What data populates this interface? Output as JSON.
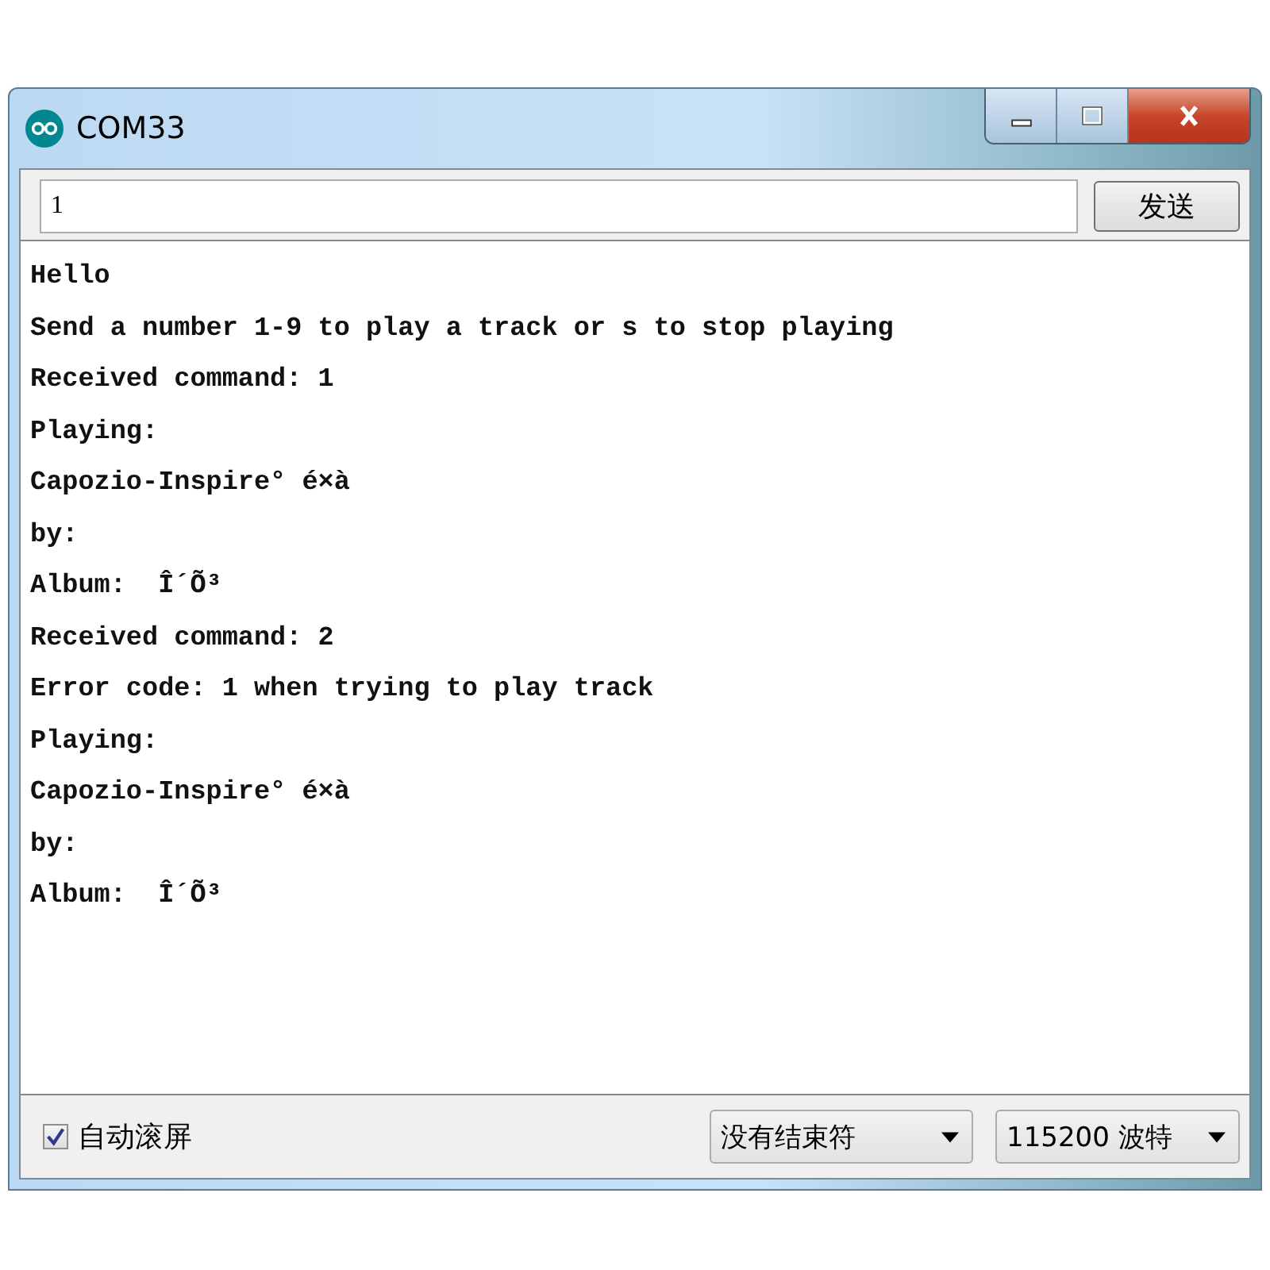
{
  "window": {
    "title": "COM33"
  },
  "send_field": {
    "value": "1"
  },
  "send_button": {
    "label": "发送"
  },
  "output_lines": [
    "Hello",
    "Send a number 1-9 to play a track or s to stop playing",
    "Received command: 1",
    "Playing:",
    "Capozio-Inspire° é×à",
    "by:",
    "Album:  Î´Õ³",
    "Received command: 2",
    "Error code: 1 when trying to play track",
    "Playing:",
    "Capozio-Inspire° é×à",
    "by:",
    "Album:  Î´Õ³"
  ],
  "autoscroll": {
    "label": "自动滚屏",
    "checked": true
  },
  "line_ending": {
    "value": "没有结束符"
  },
  "baud_rate": {
    "value": "115200 波特"
  }
}
